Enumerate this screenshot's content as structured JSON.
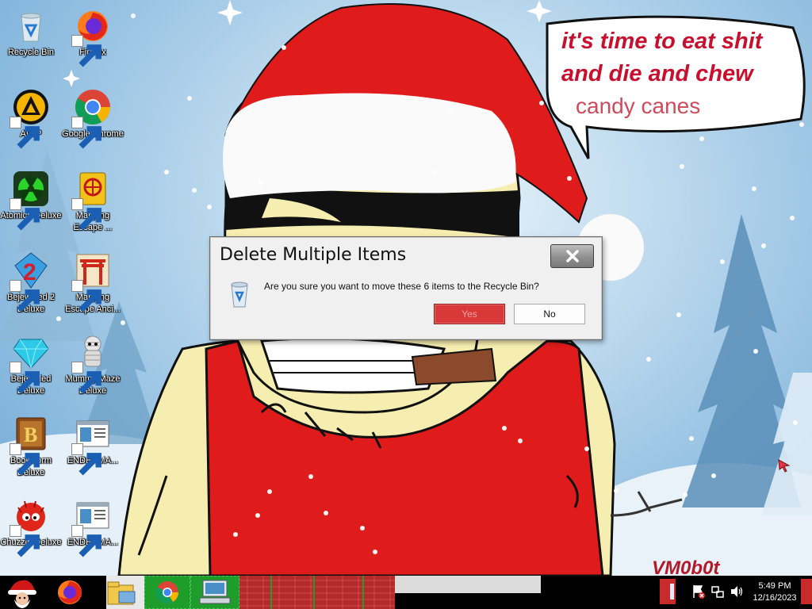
{
  "wallpaper": {
    "speech_line1": "it's time to eat shit",
    "speech_line2": "and die and chew",
    "speech_line3": "candy canes",
    "watermark": "VM0b0t"
  },
  "desktop_icons": [
    {
      "label": "Recycle Bin",
      "icon": "recycle-bin-icon"
    },
    {
      "label": "Firefox",
      "icon": "firefox-icon"
    },
    {
      "label": "AIMP",
      "icon": "aimp-icon"
    },
    {
      "label": "Google Chrome",
      "icon": "chrome-icon"
    },
    {
      "label": "Atomica Deluxe",
      "icon": "atomica-icon"
    },
    {
      "label": "Mahjong Escape ...",
      "icon": "mahjong-icon"
    },
    {
      "label": "Bejeweled 2 Deluxe",
      "icon": "bejeweled2-icon"
    },
    {
      "label": "Mahjong Escape Anci...",
      "icon": "mahjong-gate-icon"
    },
    {
      "label": "Bejeweled Deluxe",
      "icon": "bejeweled-icon"
    },
    {
      "label": "Mummy Maze Deluxe",
      "icon": "mummy-icon"
    },
    {
      "label": "Bookworm Deluxe",
      "icon": "bookworm-icon"
    },
    {
      "label": "ENDERMA...",
      "icon": "app-window-icon"
    },
    {
      "label": "Chuzzle Deluxe",
      "icon": "chuzzle-icon"
    },
    {
      "label": "ENDERMA...",
      "icon": "app-window-icon"
    }
  ],
  "dialog": {
    "title": "Delete Multiple Items",
    "message": "Are you sure you want to move these 6 items to the Recycle Bin?",
    "yes_label": "Yes",
    "no_label": "No"
  },
  "taskbar": {
    "start_icon": "santa-start-icon",
    "pinned": [
      "firefox-icon",
      "file-explorer-icon",
      "chrome-icon",
      "computer-icon"
    ],
    "tray": {
      "icons": [
        "action-center-flag-icon",
        "network-icon",
        "volume-icon"
      ],
      "time": "5:49 PM",
      "date": "12/16/2023"
    }
  },
  "colors": {
    "dialog_yes_bg": "#d83838",
    "speech_text": "#c8102e",
    "taskbar_bg": "#000000"
  }
}
